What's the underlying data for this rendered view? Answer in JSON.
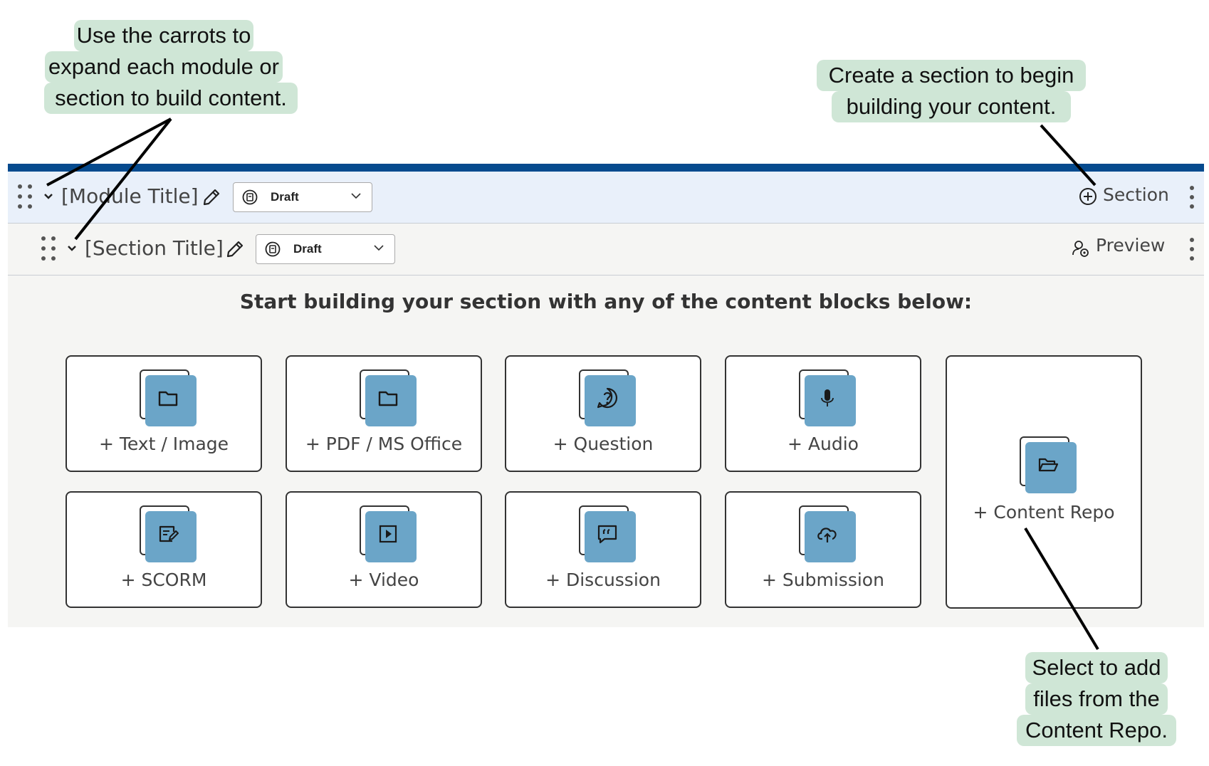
{
  "callouts": {
    "carrots": [
      "Use the carrots to",
      "expand each module or",
      "section to build content."
    ],
    "section": [
      "Create a section to begin",
      "building your content."
    ],
    "repo": [
      "Select to add",
      "files from the",
      "Content Repo."
    ]
  },
  "module": {
    "title": "[Module Title]",
    "status": "Draft",
    "action_label": "Section",
    "action_icon": "plus-circle-icon"
  },
  "section": {
    "title": "[Section Title]",
    "status": "Draft",
    "action_label": "Preview",
    "action_icon": "user-preview-icon"
  },
  "content": {
    "headline": "Start building your section with any of the content blocks below:",
    "blocks": [
      {
        "label": "+ Text / Image",
        "icon": "folder-icon"
      },
      {
        "label": "+ PDF / MS Office",
        "icon": "folder-icon"
      },
      {
        "label": "+ Question",
        "icon": "question-icon"
      },
      {
        "label": "+ Audio",
        "icon": "microphone-icon"
      },
      {
        "label": "+ Content Repo",
        "icon": "folder-open-icon"
      },
      {
        "label": "+ SCORM",
        "icon": "edit-icon"
      },
      {
        "label": "+ Video",
        "icon": "play-icon"
      },
      {
        "label": "+ Discussion",
        "icon": "quote-bubble-icon"
      },
      {
        "label": "+ Submission",
        "icon": "cloud-upload-icon"
      }
    ]
  },
  "colors": {
    "top_bar": "#054a8e",
    "module_row": "#e9f0fa",
    "section_row": "#f5f5f3",
    "icon_tile": "#6ba5c8",
    "callout": "#cfe6d6"
  }
}
